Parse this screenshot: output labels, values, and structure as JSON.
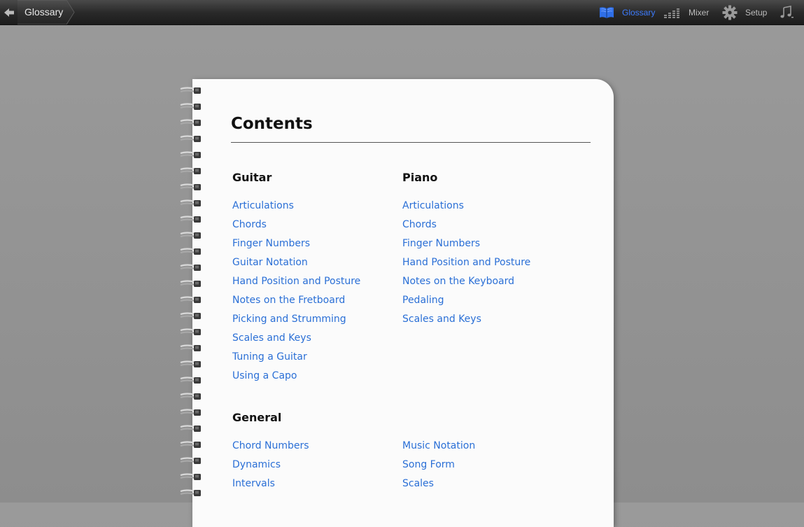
{
  "topbar": {
    "breadcrumb": "Glossary",
    "tools": [
      {
        "label": "Glossary",
        "icon": "book-icon",
        "active": true
      },
      {
        "label": "Mixer",
        "icon": "mixer-icon",
        "active": false
      },
      {
        "label": "Setup",
        "icon": "gear-icon",
        "active": false
      },
      {
        "label": "",
        "icon": "music-note-icon",
        "active": false
      }
    ]
  },
  "notebook": {
    "title": "Contents",
    "guitar": {
      "heading": "Guitar",
      "items": [
        "Articulations",
        "Chords",
        "Finger Numbers",
        "Guitar Notation",
        "Hand Position and Posture",
        "Notes on the Fretboard",
        "Picking and Strumming",
        "Scales and Keys",
        "Tuning a Guitar",
        "Using a Capo"
      ]
    },
    "piano": {
      "heading": "Piano",
      "items": [
        "Articulations",
        "Chords",
        "Finger Numbers",
        "Hand Position and Posture",
        "Notes on the Keyboard",
        "Pedaling",
        "Scales and Keys"
      ]
    },
    "general": {
      "heading": "General",
      "left": [
        "Chord Numbers",
        "Dynamics",
        "Intervals"
      ],
      "right": [
        "Music Notation",
        "Song Form",
        "Scales"
      ]
    }
  },
  "colors": {
    "link": "#2a6fd6",
    "active_tool": "#3d7cff"
  }
}
